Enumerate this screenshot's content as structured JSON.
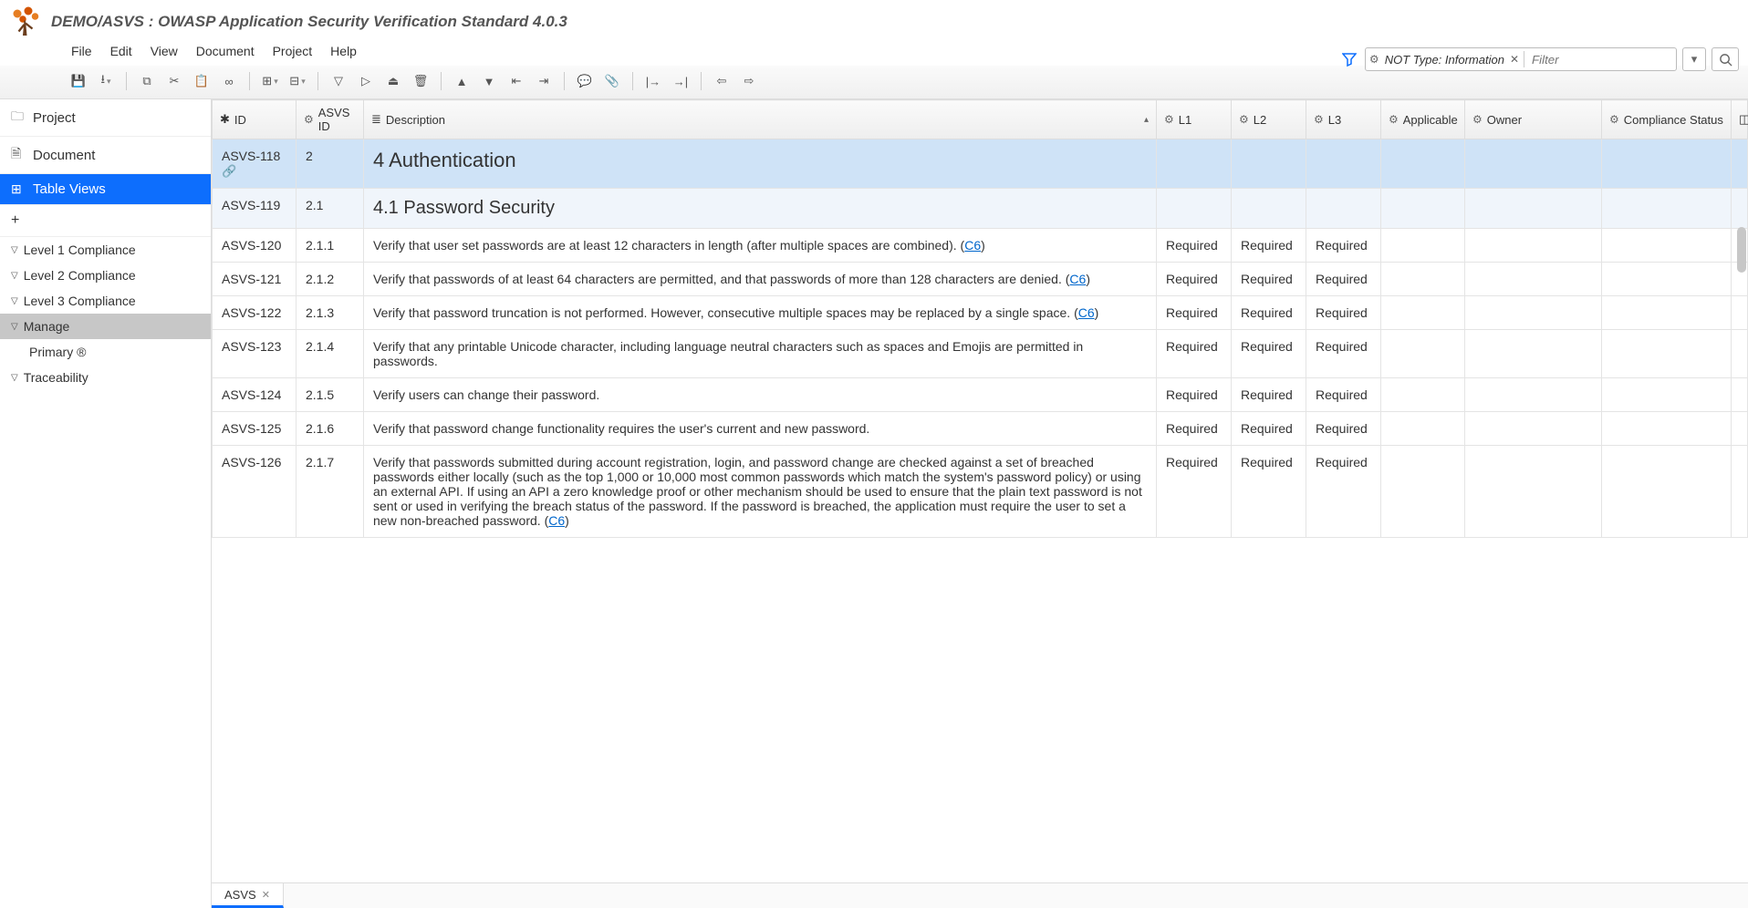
{
  "header": {
    "title": "DEMO/ASVS : OWASP Application Security Verification Standard 4.0.3"
  },
  "menubar": [
    "File",
    "Edit",
    "View",
    "Document",
    "Project",
    "Help"
  ],
  "filter": {
    "chip_text": "NOT Type: Information",
    "placeholder": "Filter"
  },
  "sidebar": {
    "project": "Project",
    "document": "Document",
    "table_views": "Table Views",
    "tree": [
      {
        "label": "Level 1 Compliance"
      },
      {
        "label": "Level 2 Compliance"
      },
      {
        "label": "Level 3 Compliance"
      },
      {
        "label": "Manage",
        "selected": true,
        "children": [
          {
            "label": "Primary ®"
          }
        ]
      },
      {
        "label": "Traceability"
      }
    ]
  },
  "columns": {
    "id": "ID",
    "asvs_id": "ASVS ID",
    "description": "Description",
    "l1": "L1",
    "l2": "L2",
    "l3": "L3",
    "applicable": "Applicable",
    "owner": "Owner",
    "compliance": "Compliance Status"
  },
  "rows": [
    {
      "id": "ASVS-118",
      "link": true,
      "asvs": "2",
      "type": "section",
      "desc": "4 Authentication"
    },
    {
      "id": "ASVS-119",
      "asvs": "2.1",
      "type": "subsection",
      "desc": "4.1 Password Security"
    },
    {
      "id": "ASVS-120",
      "asvs": "2.1.1",
      "desc": "Verify that user set passwords are at least 12 characters in length (after multiple spaces are combined). ",
      "ref": "C6",
      "l1": "Required",
      "l2": "Required",
      "l3": "Required"
    },
    {
      "id": "ASVS-121",
      "asvs": "2.1.2",
      "desc": "Verify that passwords of at least 64 characters are permitted, and that passwords of more than 128 characters are denied. ",
      "ref": "C6",
      "l1": "Required",
      "l2": "Required",
      "l3": "Required"
    },
    {
      "id": "ASVS-122",
      "asvs": "2.1.3",
      "desc": "Verify that password truncation is not performed. However, consecutive multiple spaces may be replaced by a single space. ",
      "ref": "C6",
      "l1": "Required",
      "l2": "Required",
      "l3": "Required"
    },
    {
      "id": "ASVS-123",
      "asvs": "2.1.4",
      "desc": "Verify that any printable Unicode character, including language neutral characters such as spaces and Emojis are permitted in passwords.",
      "l1": "Required",
      "l2": "Required",
      "l3": "Required"
    },
    {
      "id": "ASVS-124",
      "asvs": "2.1.5",
      "desc": "Verify users can change their password.",
      "l1": "Required",
      "l2": "Required",
      "l3": "Required"
    },
    {
      "id": "ASVS-125",
      "asvs": "2.1.6",
      "desc": "Verify that password change functionality requires the user's current and new password.",
      "l1": "Required",
      "l2": "Required",
      "l3": "Required"
    },
    {
      "id": "ASVS-126",
      "asvs": "2.1.7",
      "desc": "Verify that passwords submitted during account registration, login, and password change are checked against a set of breached passwords either locally (such as the top 1,000 or 10,000 most common passwords which match the system's password policy) or using an external API. If using an API a zero knowledge proof or other mechanism should be used to ensure that the plain text password is not sent or used in verifying the breach status of the password. If the password is breached, the application must require the user to set a new non-breached password. ",
      "ref": "C6",
      "l1": "Required",
      "l2": "Required",
      "l3": "Required"
    }
  ],
  "tab": {
    "label": "ASVS"
  },
  "ref_open": "(",
  "ref_close": ")"
}
